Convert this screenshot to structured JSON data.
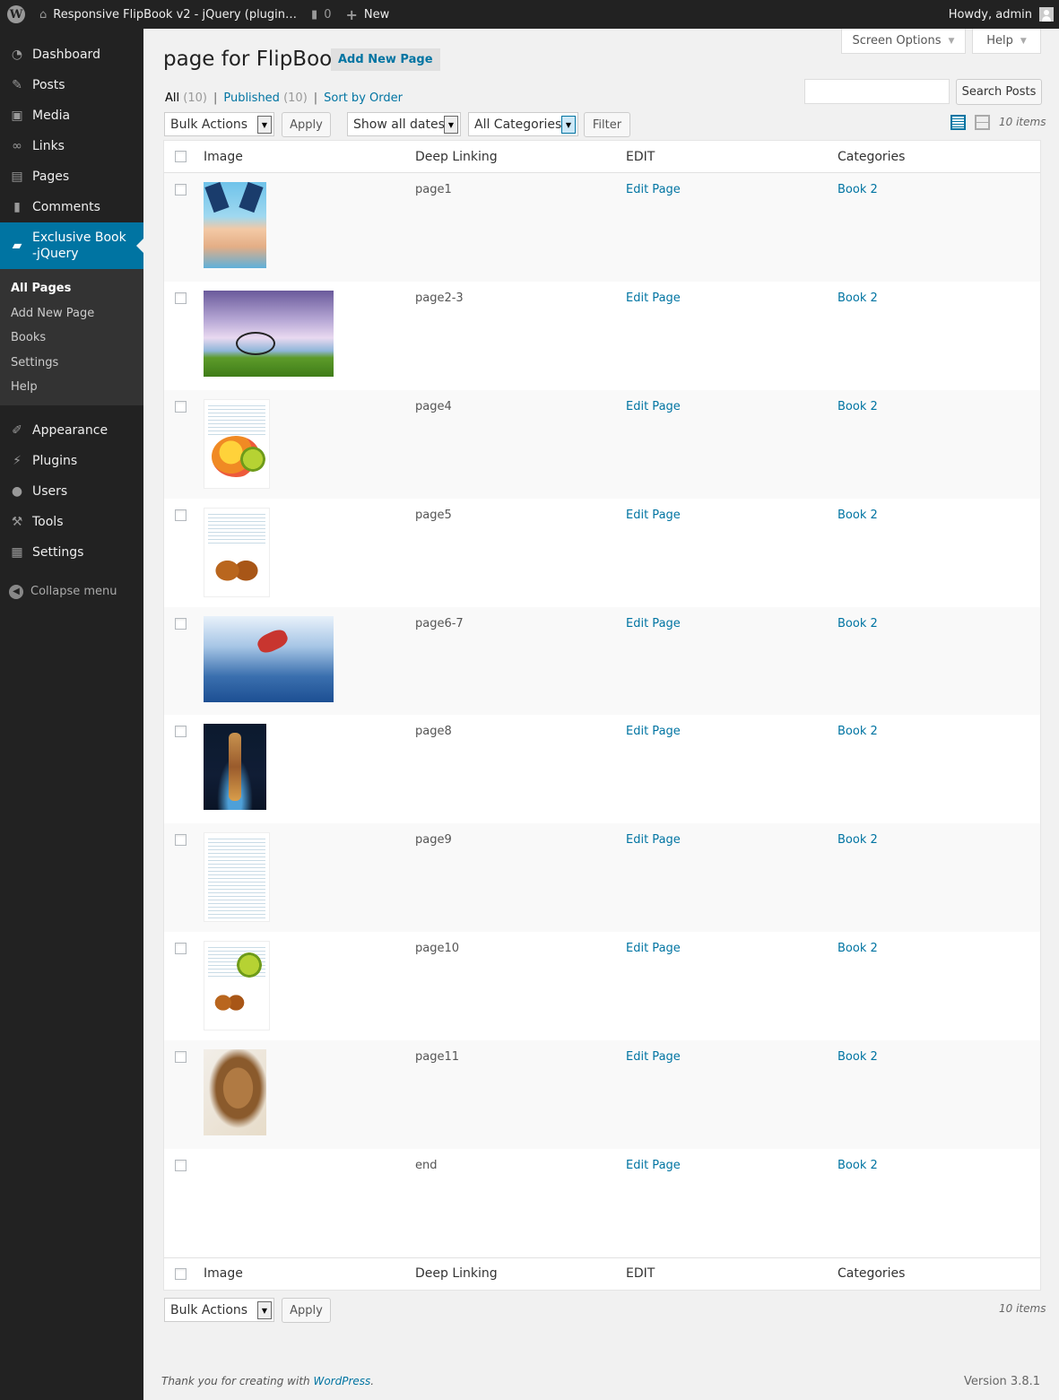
{
  "adminbar": {
    "site_title": "Responsive FlipBook v2 - jQuery (plugin…",
    "comments_count": "0",
    "new_label": "New",
    "howdy": "Howdy, admin"
  },
  "sidebar": {
    "items_top": [
      {
        "label": "Dashboard",
        "icon": "dashboard-icon"
      },
      {
        "label": "Posts",
        "icon": "pin-icon"
      },
      {
        "label": "Media",
        "icon": "media-icon"
      },
      {
        "label": "Links",
        "icon": "link-icon"
      },
      {
        "label": "Pages",
        "icon": "pages-icon"
      },
      {
        "label": "Comments",
        "icon": "comment-icon"
      }
    ],
    "current": {
      "label": "Exclusive Book -jQuery",
      "icon": "book-icon"
    },
    "submenu": [
      "All Pages",
      "Add New Page",
      "Books",
      "Settings",
      "Help"
    ],
    "items_bottom": [
      {
        "label": "Appearance",
        "icon": "brush-icon"
      },
      {
        "label": "Plugins",
        "icon": "plug-icon"
      },
      {
        "label": "Users",
        "icon": "user-icon"
      },
      {
        "label": "Tools",
        "icon": "wrench-icon"
      },
      {
        "label": "Settings",
        "icon": "settings-icon"
      }
    ],
    "collapse_label": "Collapse menu"
  },
  "screen_options": {
    "label": "Screen Options",
    "help_label": "Help"
  },
  "page": {
    "title": "page for FlipBook",
    "add_new_label": "Add New Page"
  },
  "views": {
    "all_label": "All",
    "all_count": "(10)",
    "published_label": "Published",
    "published_count": "(10)",
    "sort_label": "Sort by Order"
  },
  "search": {
    "button_label": "Search Posts",
    "value": ""
  },
  "filters": {
    "bulk_actions": "Bulk Actions",
    "apply_label": "Apply",
    "dates": "Show all dates",
    "categories": "All Categories",
    "filter_label": "Filter",
    "items_count": "10 items"
  },
  "table": {
    "columns": [
      "Image",
      "Deep Linking",
      "EDIT",
      "Categories"
    ],
    "rows": [
      {
        "deep_link": "page1",
        "edit": "Edit Page",
        "category": "Book 2",
        "thumb": "snorkel"
      },
      {
        "deep_link": "page2-3",
        "edit": "Edit Page",
        "category": "Book 2",
        "thumb": "bike"
      },
      {
        "deep_link": "page4",
        "edit": "Edit Page",
        "category": "Book 2",
        "thumb": "doc-fruit"
      },
      {
        "deep_link": "page5",
        "edit": "Edit Page",
        "category": "Book 2",
        "thumb": "doc-glass"
      },
      {
        "deep_link": "page6-7",
        "edit": "Edit Page",
        "category": "Book 2",
        "thumb": "sky"
      },
      {
        "deep_link": "page8",
        "edit": "Edit Page",
        "category": "Book 2",
        "thumb": "dancer"
      },
      {
        "deep_link": "page9",
        "edit": "Edit Page",
        "category": "Book 2",
        "thumb": "doc-text"
      },
      {
        "deep_link": "page10",
        "edit": "Edit Page",
        "category": "Book 2",
        "thumb": "doc-fruit-glass"
      },
      {
        "deep_link": "page11",
        "edit": "Edit Page",
        "category": "Book 2",
        "thumb": "lion"
      },
      {
        "deep_link": "end",
        "edit": "Edit Page",
        "category": "Book 2",
        "thumb": "end"
      }
    ]
  },
  "footer": {
    "thanks_prefix": "Thank you for creating with",
    "wordpress_link": "WordPress",
    "thanks_suffix": ".",
    "version": "Version 3.8.1"
  },
  "colors": {
    "accent": "#0074a2",
    "adminbar": "#222222",
    "page_bg": "#f1f1f1"
  }
}
